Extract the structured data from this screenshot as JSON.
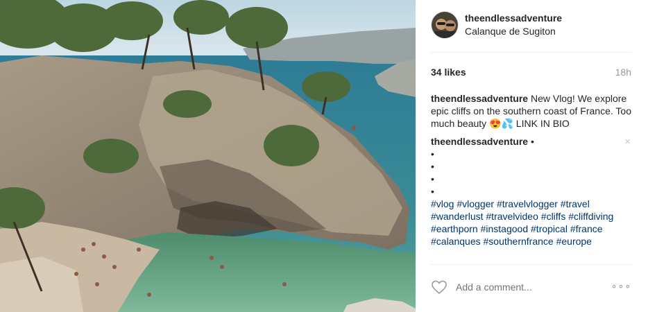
{
  "post": {
    "username": "theendlessadventure",
    "location": "Calanque de Sugiton",
    "likes": "34 likes",
    "time": "18h",
    "caption": {
      "author": "theendlessadventure",
      "text": "New Vlog! We explore epic cliffs on the southern coast of France. Too much beauty 😍💦 LINK IN BIO"
    },
    "comment": {
      "author": "theendlessadventure",
      "separator": "•",
      "dots": [
        "•",
        "•",
        "•",
        "•"
      ],
      "hashtags": [
        "#vlog",
        "#vlogger",
        "#travelvlogger",
        "#travel",
        "#wanderlust",
        "#travelvideo",
        "#cliffs",
        "#cliffdiving",
        "#earthporn",
        "#instagood",
        "#tropical",
        "#france",
        "#calanques",
        "#southernfrance",
        "#europe"
      ],
      "close_icon": "×"
    },
    "add_comment_placeholder": "Add a comment...",
    "more_icon": "∘∘∘"
  },
  "icons": {
    "heart": "heart-icon",
    "close": "close-icon",
    "more": "more-options-icon"
  }
}
